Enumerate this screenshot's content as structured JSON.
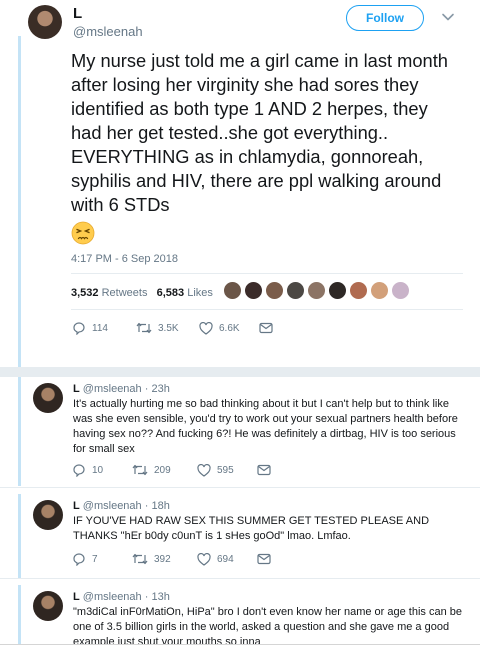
{
  "main_tweet": {
    "name": "L",
    "handle": "@msleenah",
    "follow_label": "Follow",
    "text": "My nurse just told me a girl came in last month after losing her virginity she had sores they identified as both type 1 AND 2 herpes, they had her get tested..she got everything.. EVERYTHING as in chlamydia, gonnoreah, syphilis and HIV, there are ppl walking around with 6 STDs",
    "emoji": "persevering-face-emoji",
    "timestamp": "4:17 PM - 6 Sep 2018",
    "retweets_count": "3,532",
    "retweets_label": "Retweets",
    "likes_count": "6,583",
    "likes_label": "Likes",
    "replies": "114",
    "retweets": "3.5K",
    "likes": "6.6K"
  },
  "replies": [
    {
      "name": "L",
      "handle": "@msleenah",
      "time": "· 23h",
      "text": "It's actually hurting me so bad thinking about it but I can't help but to think like was she even sensible, you'd try to work out your sexual partners health before having sex no?? And fucking 6?! He was definitely a dirtbag, HIV is too serious for small sex",
      "replies": "10",
      "retweets": "209",
      "likes": "595"
    },
    {
      "name": "L",
      "handle": "@msleenah",
      "time": "· 18h",
      "text": "IF YOU'VE HAD RAW SEX THIS SUMMER GET TESTED PLEASE AND THANKS \"hEr b0dy c0unT is 1 sHes goOd\" lmao. Lmfao.",
      "replies": "7",
      "retweets": "392",
      "likes": "694"
    },
    {
      "name": "L",
      "handle": "@msleenah",
      "time": "· 13h",
      "text": "\"m3diCal inF0rMatiOn, HiPa\" bro I don't even know her name or age this can be one of 3.5 billion girls in the world, asked a question and she gave me a good example just shut your mouths so inna"
    }
  ],
  "colors": {
    "accent": "#1da1f2",
    "thread_line": "#c4e3f6",
    "muted": "#657786"
  }
}
